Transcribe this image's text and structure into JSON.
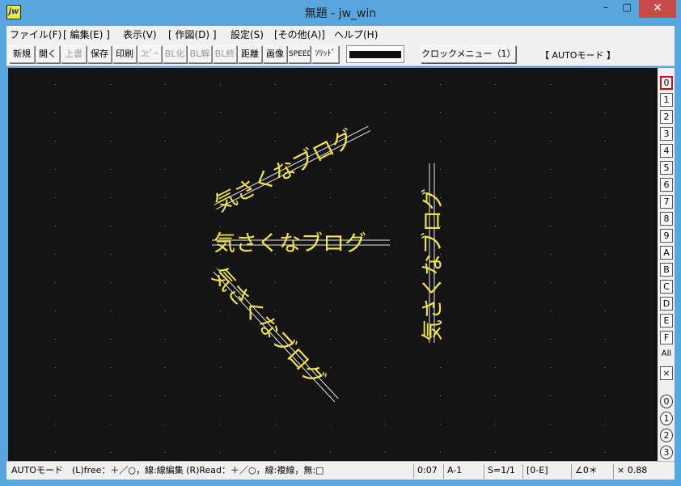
{
  "window": {
    "title": "無題 - jw_win",
    "app_icon": "jw",
    "min_glyph": "–",
    "max_glyph": "▢",
    "close_glyph": "✕"
  },
  "menu": [
    "ファイル(F)",
    "[ 編集(E) ]",
    "表示(V)",
    "[ 作図(D) ]",
    "設定(S)",
    "[その他(A)]",
    "ヘルプ(H)"
  ],
  "toolbar": {
    "buttons": [
      {
        "label": "新規",
        "enabled": true
      },
      {
        "label": "開く",
        "enabled": true
      },
      {
        "label": "上書",
        "enabled": false
      },
      {
        "label": "保存",
        "enabled": true
      },
      {
        "label": "印刷",
        "enabled": true
      },
      {
        "label": "ｺﾋﾟｰ",
        "enabled": false
      },
      {
        "label": "BL化",
        "enabled": false
      },
      {
        "label": "BL解",
        "enabled": false
      },
      {
        "label": "BL終",
        "enabled": false
      },
      {
        "label": "距離",
        "enabled": true
      },
      {
        "label": "画像",
        "enabled": true
      },
      {
        "label": "SPEED",
        "enabled": true
      },
      {
        "label": "ｿﾘｯﾄﾞ",
        "enabled": true
      }
    ],
    "clock_menu": "クロックメニュー（1）",
    "mode": "【 AUTOモード 】"
  },
  "canvas": {
    "text": "気さくなブログ",
    "text_color": "#f5e642",
    "guide_color": "#e8e8e8",
    "background": "#141414"
  },
  "layers": [
    "0",
    "1",
    "2",
    "3",
    "4",
    "5",
    "6",
    "7",
    "8",
    "9",
    "A",
    "B",
    "C",
    "D",
    "E",
    "F",
    "All",
    "×"
  ],
  "layer_groups": [
    "0",
    "1",
    "2",
    "3"
  ],
  "status": {
    "hint": "AUTOモード　(L)free：＋／○，線:線編集 (R)Read：＋／○，線:複線，無:□",
    "time": "0:07",
    "paper": "A-1",
    "scale": "S=1/1",
    "layer": "[0-E]",
    "angle": "∠0＊",
    "zoom": "× 0.88"
  }
}
